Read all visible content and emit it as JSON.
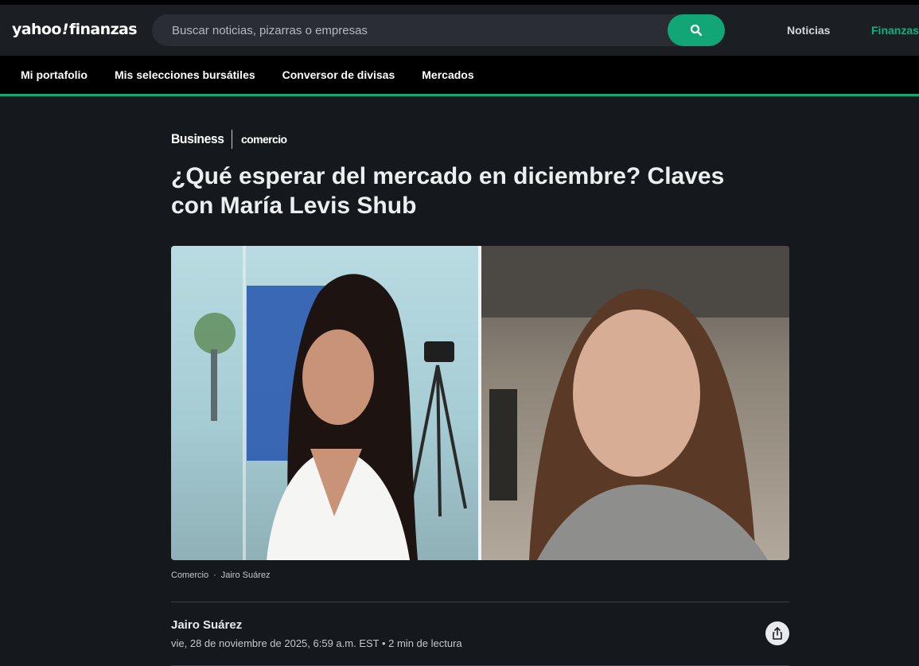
{
  "header": {
    "logo_main": "yahoo",
    "logo_bang": "!",
    "logo_sub": "finanzas",
    "search_placeholder": "Buscar noticias, pizarras o empresas",
    "search_icon": "search-icon",
    "nav_noticias": "Noticias",
    "nav_finanzas": "Finanzas",
    "accent_color": "#12a676"
  },
  "subnav": {
    "items": [
      {
        "label": "Mi portafolio"
      },
      {
        "label": "Mis selecciones bursátiles"
      },
      {
        "label": "Conversor de divisas"
      },
      {
        "label": "Mercados"
      }
    ]
  },
  "article": {
    "brand_primary": "Business",
    "brand_secondary": "comercio",
    "title": "¿Qué esperar del mercado en diciembre? Claves con María Levis Shub",
    "media_credit_source": "Comercio",
    "media_credit_sep": "·",
    "media_credit_author": "Jairo Suárez",
    "author": "Jairo Suárez",
    "meta": "vie, 28 de noviembre de 2025, 6:59 a.m. EST • 2 min de lectura",
    "share_icon": "share-icon"
  }
}
